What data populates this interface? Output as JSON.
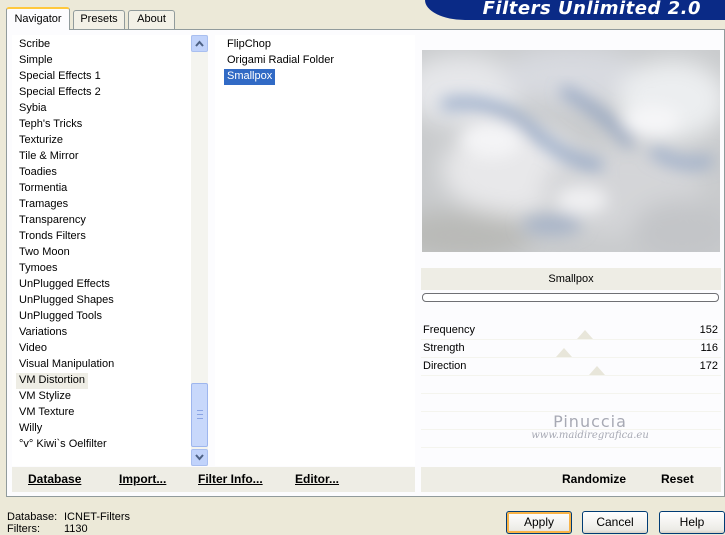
{
  "banner": {
    "title": "Filters Unlimited 2.0"
  },
  "tabs": [
    {
      "label": "Navigator",
      "active": true
    },
    {
      "label": "Presets",
      "active": false
    },
    {
      "label": "About",
      "active": false
    }
  ],
  "categories": {
    "items": [
      "Scribe",
      "Simple",
      "Special Effects 1",
      "Special Effects 2",
      "Sybia",
      "Teph's Tricks",
      "Texturize",
      "Tile & Mirror",
      "Toadies",
      "Tormentia",
      "Tramages",
      "Transparency",
      "Tronds Filters",
      "Two Moon",
      "Tymoes",
      "UnPlugged Effects",
      "UnPlugged Shapes",
      "UnPlugged Tools",
      "Variations",
      "Video",
      "Visual Manipulation",
      "VM Distortion",
      "VM Stylize",
      "VM Texture",
      "Willy",
      "°v° Kiwi`s Oelfilter"
    ],
    "selected": "VM Distortion"
  },
  "filters": {
    "items": [
      "FlipChop",
      "Origami Radial Folder",
      "Smallpox"
    ],
    "selected": "Smallpox"
  },
  "preview": {
    "filter_name": "Smallpox",
    "progress": 0
  },
  "parameters": [
    {
      "name": "Frequency",
      "value": "152",
      "level": 0.596
    },
    {
      "name": "Strength",
      "value": "116",
      "level": 0.455
    },
    {
      "name": "Direction",
      "value": "172",
      "level": 0.675
    }
  ],
  "watermark": {
    "name": "Pinuccia",
    "url": "www.maidiregrafica.eu"
  },
  "action_left": {
    "database": "Database",
    "import": "Import...",
    "filter_info": "Filter Info...",
    "editor": "Editor..."
  },
  "action_right": {
    "randomize": "Randomize",
    "reset": "Reset"
  },
  "status": {
    "database_label": "Database:",
    "database_value": "ICNET-Filters",
    "filters_label": "Filters:",
    "filters_value": "1130"
  },
  "buttons": {
    "apply": "Apply",
    "cancel": "Cancel",
    "help": "Help"
  },
  "colors": {
    "banner": "#0a2a86",
    "selection": "#316ac5",
    "panel_bg": "#ece9d8"
  }
}
